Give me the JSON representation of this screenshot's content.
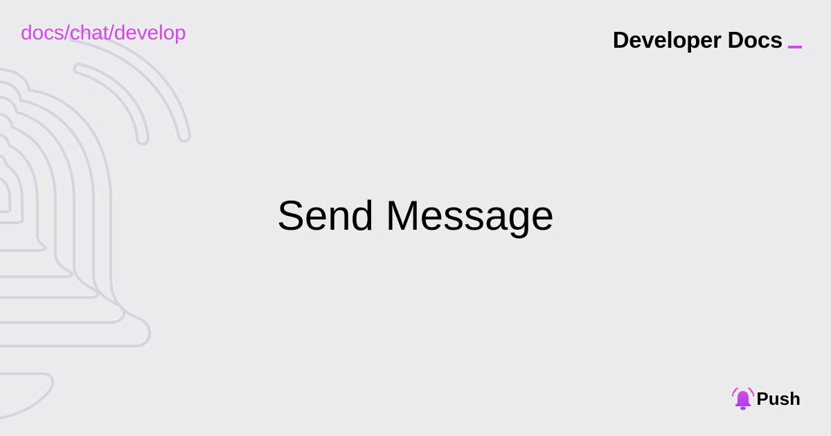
{
  "breadcrumb": "docs/chat/develop",
  "brand": {
    "title": "Developer Docs",
    "cursor_icon": "underscore-cursor",
    "accent_color": "#d548ec"
  },
  "main": {
    "title": "Send Message"
  },
  "logo": {
    "icon": "push-bell-icon",
    "text": "Push"
  },
  "background": {
    "color": "#ececee",
    "decoration_icon": "bell-outline-icon",
    "decoration_color": "#d6d5df"
  }
}
